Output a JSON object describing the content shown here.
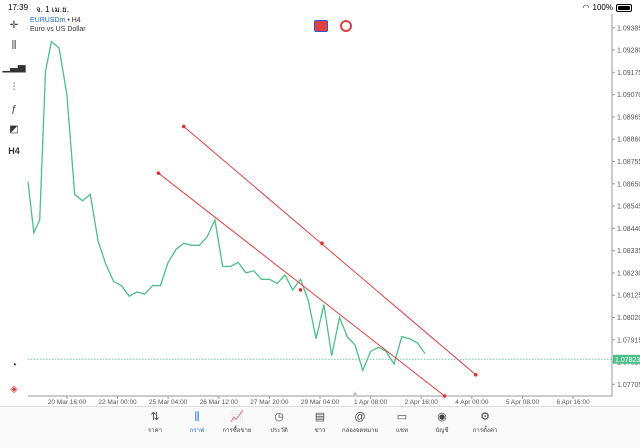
{
  "status_bar": {
    "time": "17:39",
    "date": "จ. 1 เม.ย.",
    "battery": "100%"
  },
  "symbol": {
    "name": "EURUSDm",
    "timeframe_suffix": " • H4",
    "description": "Euro vs US Dollar"
  },
  "left_tools": [
    {
      "name": "crosshair-icon",
      "glyph": "✛"
    },
    {
      "name": "chart-type-icon",
      "glyph": "⫼"
    },
    {
      "name": "indicators-icon",
      "glyph": "▁▃▅"
    },
    {
      "name": "settings-sliders-icon",
      "glyph": "⫶"
    },
    {
      "name": "function-icon",
      "glyph": "ƒ"
    },
    {
      "name": "objects-icon",
      "glyph": "◩"
    },
    {
      "name": "timeframe-button",
      "glyph": "H4"
    }
  ],
  "chart_data": {
    "type": "line",
    "series": [
      {
        "color": "#4cbf8a",
        "points": [
          [
            0,
            1.0866
          ],
          [
            3,
            1.0842
          ],
          [
            6,
            1.0848
          ],
          [
            9,
            1.0918
          ],
          [
            12,
            1.0932
          ],
          [
            16,
            1.0929
          ],
          [
            20,
            1.0907
          ],
          [
            24,
            1.086
          ],
          [
            28,
            1.0857
          ],
          [
            32,
            1.086
          ],
          [
            36,
            1.0838
          ],
          [
            40,
            1.0827
          ],
          [
            44,
            1.0819
          ],
          [
            48,
            1.0817
          ],
          [
            52,
            1.0812
          ],
          [
            56,
            1.0814
          ],
          [
            60,
            1.0813
          ],
          [
            64,
            1.0817
          ],
          [
            68,
            1.0817
          ],
          [
            72,
            1.0828
          ],
          [
            76,
            1.0834
          ],
          [
            80,
            1.0837
          ],
          [
            84,
            1.0836
          ],
          [
            88,
            1.0836
          ],
          [
            92,
            1.084
          ],
          [
            96,
            1.0848
          ],
          [
            100,
            1.0826
          ],
          [
            104,
            1.0826
          ],
          [
            108,
            1.0828
          ],
          [
            112,
            1.0823
          ],
          [
            116,
            1.0824
          ],
          [
            120,
            1.082
          ],
          [
            124,
            1.082
          ],
          [
            128,
            1.0818
          ],
          [
            132,
            1.0822
          ],
          [
            136,
            1.0815
          ],
          [
            140,
            1.082
          ],
          [
            144,
            1.081
          ],
          [
            148,
            1.0792
          ],
          [
            152,
            1.0808
          ],
          [
            156,
            1.0784
          ],
          [
            160,
            1.0802
          ],
          [
            164,
            1.0793
          ],
          [
            168,
            1.0789
          ],
          [
            172,
            1.0777
          ],
          [
            176,
            1.0786
          ],
          [
            180,
            1.0788
          ],
          [
            184,
            1.0786
          ],
          [
            188,
            1.078
          ],
          [
            192,
            1.0793
          ],
          [
            196,
            1.0792
          ],
          [
            200,
            1.079
          ],
          [
            204,
            1.0785
          ]
        ]
      }
    ],
    "trendlines": [
      {
        "color": "#e03030",
        "from": [
          80,
          1.0892
        ],
        "mid": [
          151,
          1.0837
        ],
        "to": [
          230,
          1.0775
        ]
      },
      {
        "color": "#e03030",
        "from": [
          67,
          1.087
        ],
        "mid": [
          140,
          1.0815
        ],
        "to": [
          214,
          1.0765
        ]
      }
    ],
    "current_price": {
      "value": 1.07823,
      "label": "1.07823",
      "color": "#4cbf8a"
    },
    "y_ticks": [
      "1.09385",
      "1.09280",
      "1.09175",
      "1.09070",
      "1.08965",
      "1.08860",
      "1.08755",
      "1.08650",
      "1.08545",
      "1.08440",
      "1.08335",
      "1.08230",
      "1.08125",
      "1.08020",
      "1.07915",
      "1.07810",
      "1.07705"
    ],
    "x_ticks": [
      "20 Mar 16:00",
      "22 Mar 00:00",
      "25 Mar 04:00",
      "26 Mar 12:00",
      "27 Mar 20:00",
      "29 Mar 04:00",
      "1 Apr 08:00",
      "2 Apr 16:00",
      "4 Apr 00:00",
      "5 Apr 08:00",
      "6 Apr 16:00"
    ],
    "x_tick_pos": [
      20,
      46,
      72,
      98,
      124,
      150,
      176,
      202,
      228,
      254,
      280
    ],
    "ylim": [
      1.0765,
      1.0945
    ],
    "xlim": [
      0,
      300
    ]
  },
  "tabs": [
    {
      "name": "tab-quotes",
      "label": "ราคา",
      "glyph": "⇅"
    },
    {
      "name": "tab-chart",
      "label": "กราฟ",
      "glyph": "⫼",
      "active": true
    },
    {
      "name": "tab-trade",
      "label": "การซื้อขาย",
      "glyph": "📈"
    },
    {
      "name": "tab-history",
      "label": "ประวัติ",
      "glyph": "◷"
    },
    {
      "name": "tab-news",
      "label": "ข่าว",
      "glyph": "▤"
    },
    {
      "name": "tab-mailbox",
      "label": "กล่องจดหมาย",
      "glyph": "@"
    },
    {
      "name": "tab-chat",
      "label": "แชท",
      "glyph": "▭"
    },
    {
      "name": "tab-account",
      "label": "บัญชี",
      "glyph": "◉"
    },
    {
      "name": "tab-settings",
      "label": "การตั้งค่า",
      "glyph": "⚙"
    }
  ]
}
